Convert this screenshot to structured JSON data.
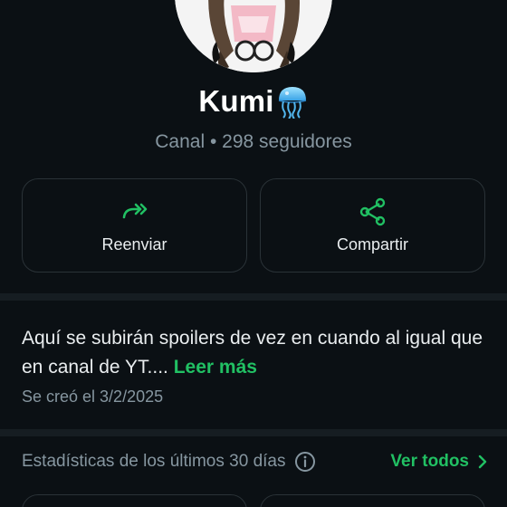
{
  "channel": {
    "name": "Kumi",
    "name_emoji": "jellyfish-emoji",
    "subtitle": "Canal • 298 seguidores"
  },
  "actions": {
    "forward_label": "Reenviar",
    "forward_icon": "forward-icon",
    "share_label": "Compartir",
    "share_icon": "share-icon"
  },
  "about": {
    "description": "Aquí se subirán spoilers de vez en cuando al igual que en canal de YT....",
    "read_more": "Leer más",
    "created": "Se creó el 3/2/2025"
  },
  "stats": {
    "label": "Estadísticas de los últimos 30 días",
    "see_all": "Ver todos"
  },
  "colors": {
    "background": "#0b1014",
    "accent": "#21c063",
    "secondary_text": "#8696a0",
    "card_border": "#2a3237"
  }
}
